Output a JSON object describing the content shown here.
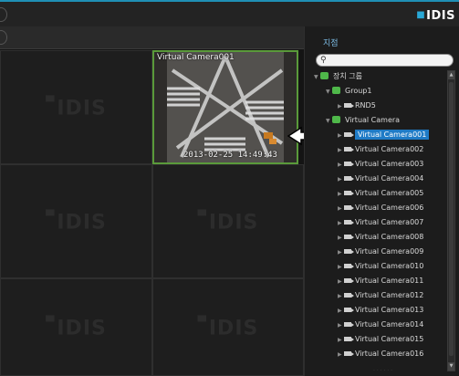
{
  "header": {
    "logo_text": "IDIS",
    "accent_color": "#1f8fb5"
  },
  "grid": {
    "watermark": "IDIS",
    "active_camera": {
      "title": "Virtual Camera001",
      "timestamp": "2013-02-25 14:49:43"
    }
  },
  "panel": {
    "title": "지점",
    "search_placeholder": "",
    "tree": [
      {
        "label": "장치 그룹",
        "type": "group",
        "level": 0,
        "expanded": true
      },
      {
        "label": "Group1",
        "type": "group",
        "level": 1,
        "expanded": true
      },
      {
        "label": "RND5",
        "type": "camera",
        "level": 2,
        "expanded": false
      },
      {
        "label": "Virtual Camera",
        "type": "group",
        "level": 1,
        "expanded": true
      },
      {
        "label": "Virtual Camera001",
        "type": "camera",
        "level": 2,
        "selected": true
      },
      {
        "label": "Virtual Camera002",
        "type": "camera",
        "level": 2
      },
      {
        "label": "Virtual Camera003",
        "type": "camera",
        "level": 2
      },
      {
        "label": "Virtual Camera004",
        "type": "camera",
        "level": 2
      },
      {
        "label": "Virtual Camera005",
        "type": "camera",
        "level": 2
      },
      {
        "label": "Virtual Camera006",
        "type": "camera",
        "level": 2
      },
      {
        "label": "Virtual Camera007",
        "type": "camera",
        "level": 2
      },
      {
        "label": "Virtual Camera008",
        "type": "camera",
        "level": 2
      },
      {
        "label": "Virtual Camera009",
        "type": "camera",
        "level": 2
      },
      {
        "label": "Virtual Camera010",
        "type": "camera",
        "level": 2
      },
      {
        "label": "Virtual Camera011",
        "type": "camera",
        "level": 2
      },
      {
        "label": "Virtual Camera012",
        "type": "camera",
        "level": 2
      },
      {
        "label": "Virtual Camera013",
        "type": "camera",
        "level": 2
      },
      {
        "label": "Virtual Camera014",
        "type": "camera",
        "level": 2
      },
      {
        "label": "Virtual Camera015",
        "type": "camera",
        "level": 2
      },
      {
        "label": "Virtual Camera016",
        "type": "camera",
        "level": 2
      }
    ]
  },
  "icons": {
    "search": "search-icon",
    "group": "group-icon",
    "camera": "camera-icon",
    "expand": "expand-triangle-icon",
    "pointer_arrow": "arrow-left-icon"
  },
  "colors": {
    "selected_bg": "#1f7bc6",
    "active_border": "#5a9a3a",
    "group_icon": "#4fb84a",
    "panel_title": "#7ab8e0"
  }
}
